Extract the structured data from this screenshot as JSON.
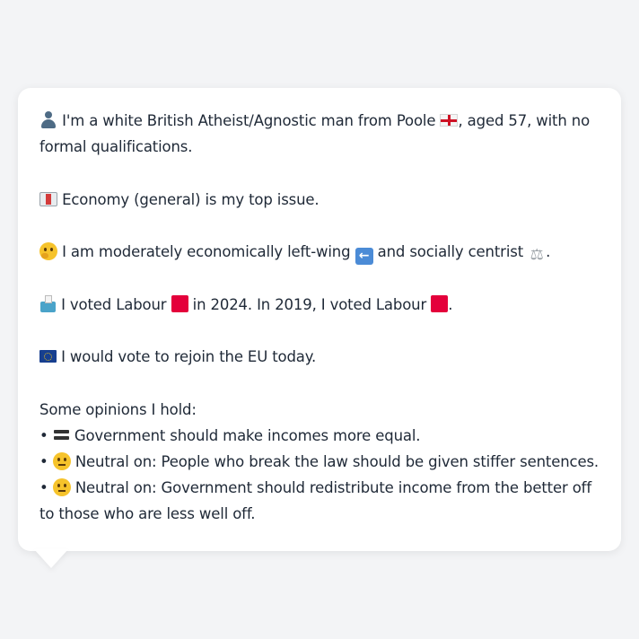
{
  "profile": {
    "intro": {
      "before_flag": "I'm a white British Atheist/Agnostic man from Poole",
      "after_flag": ", aged 57, with no formal qualifications."
    },
    "top_issue": "Economy (general) is my top issue.",
    "ideology": {
      "part1": "I am moderately economically left-wing",
      "part2": "and socially centrist",
      "part3": "."
    },
    "vote": {
      "part1": "I voted Labour",
      "part2": "in 2024. In 2019, I voted Labour",
      "part3": "."
    },
    "eu": "I would vote to rejoin the EU today.",
    "opinions_heading": "Some opinions I hold:",
    "bullet": "•",
    "opinions": [
      {
        "icon": "equals-icon",
        "text": "Government should make incomes more equal."
      },
      {
        "icon": "neutral-face-icon",
        "text": "Neutral on: People who break the law should be given stiffer sentences."
      },
      {
        "icon": "neutral-face-icon",
        "text": "Neutral on: Government should redistribute income from the better off to those who are less well off."
      }
    ]
  },
  "colors": {
    "labour_red": "#e4003b",
    "background": "#f3f4f6",
    "bubble": "#ffffff",
    "text": "#1f2937"
  }
}
